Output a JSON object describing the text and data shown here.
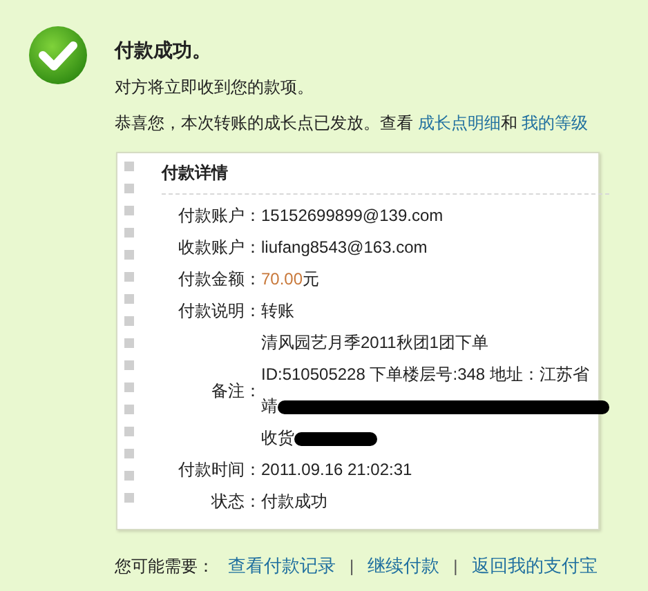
{
  "header": {
    "title": "付款成功。",
    "message": "对方将立即收到您的款项。",
    "growth_note": {
      "prefix": "恭喜您，本次转账的成长点已发放。查看 ",
      "link_1": "成长点明细",
      "joiner": "和 ",
      "link_2": "我的等级"
    }
  },
  "details": {
    "title": "付款详情",
    "rows": [
      {
        "kind": "text",
        "label": "付款账户：",
        "value": "15152699899@139.com"
      },
      {
        "kind": "text",
        "label": "收款账户：",
        "value": "liufang8543@163.com"
      },
      {
        "kind": "amount",
        "label": "付款金额：",
        "amount": "70.00",
        "unit": "元"
      },
      {
        "kind": "text",
        "label": "付款说明：",
        "value": "转账"
      },
      {
        "kind": "lines",
        "label": "备注：",
        "lines": [
          {
            "text": "清风园艺月季2011秋团1团下单",
            "kind": "plain"
          },
          {
            "text": "ID:510505228 下单楼层号:348 地址：江苏省",
            "kind": "plain"
          },
          {
            "text": "靖",
            "kind": "masked"
          },
          {
            "text": "收货",
            "kind": "stub"
          }
        ]
      },
      {
        "kind": "text",
        "label": "付款时间：",
        "value": "2011.09.16 21:02:31"
      },
      {
        "kind": "text",
        "label": "状态：",
        "value": "付款成功"
      }
    ]
  },
  "footer": {
    "label": "您可能需要：",
    "links": [
      "查看付款记录",
      "继续付款",
      "返回我的支付宝"
    ],
    "separator": "|"
  }
}
